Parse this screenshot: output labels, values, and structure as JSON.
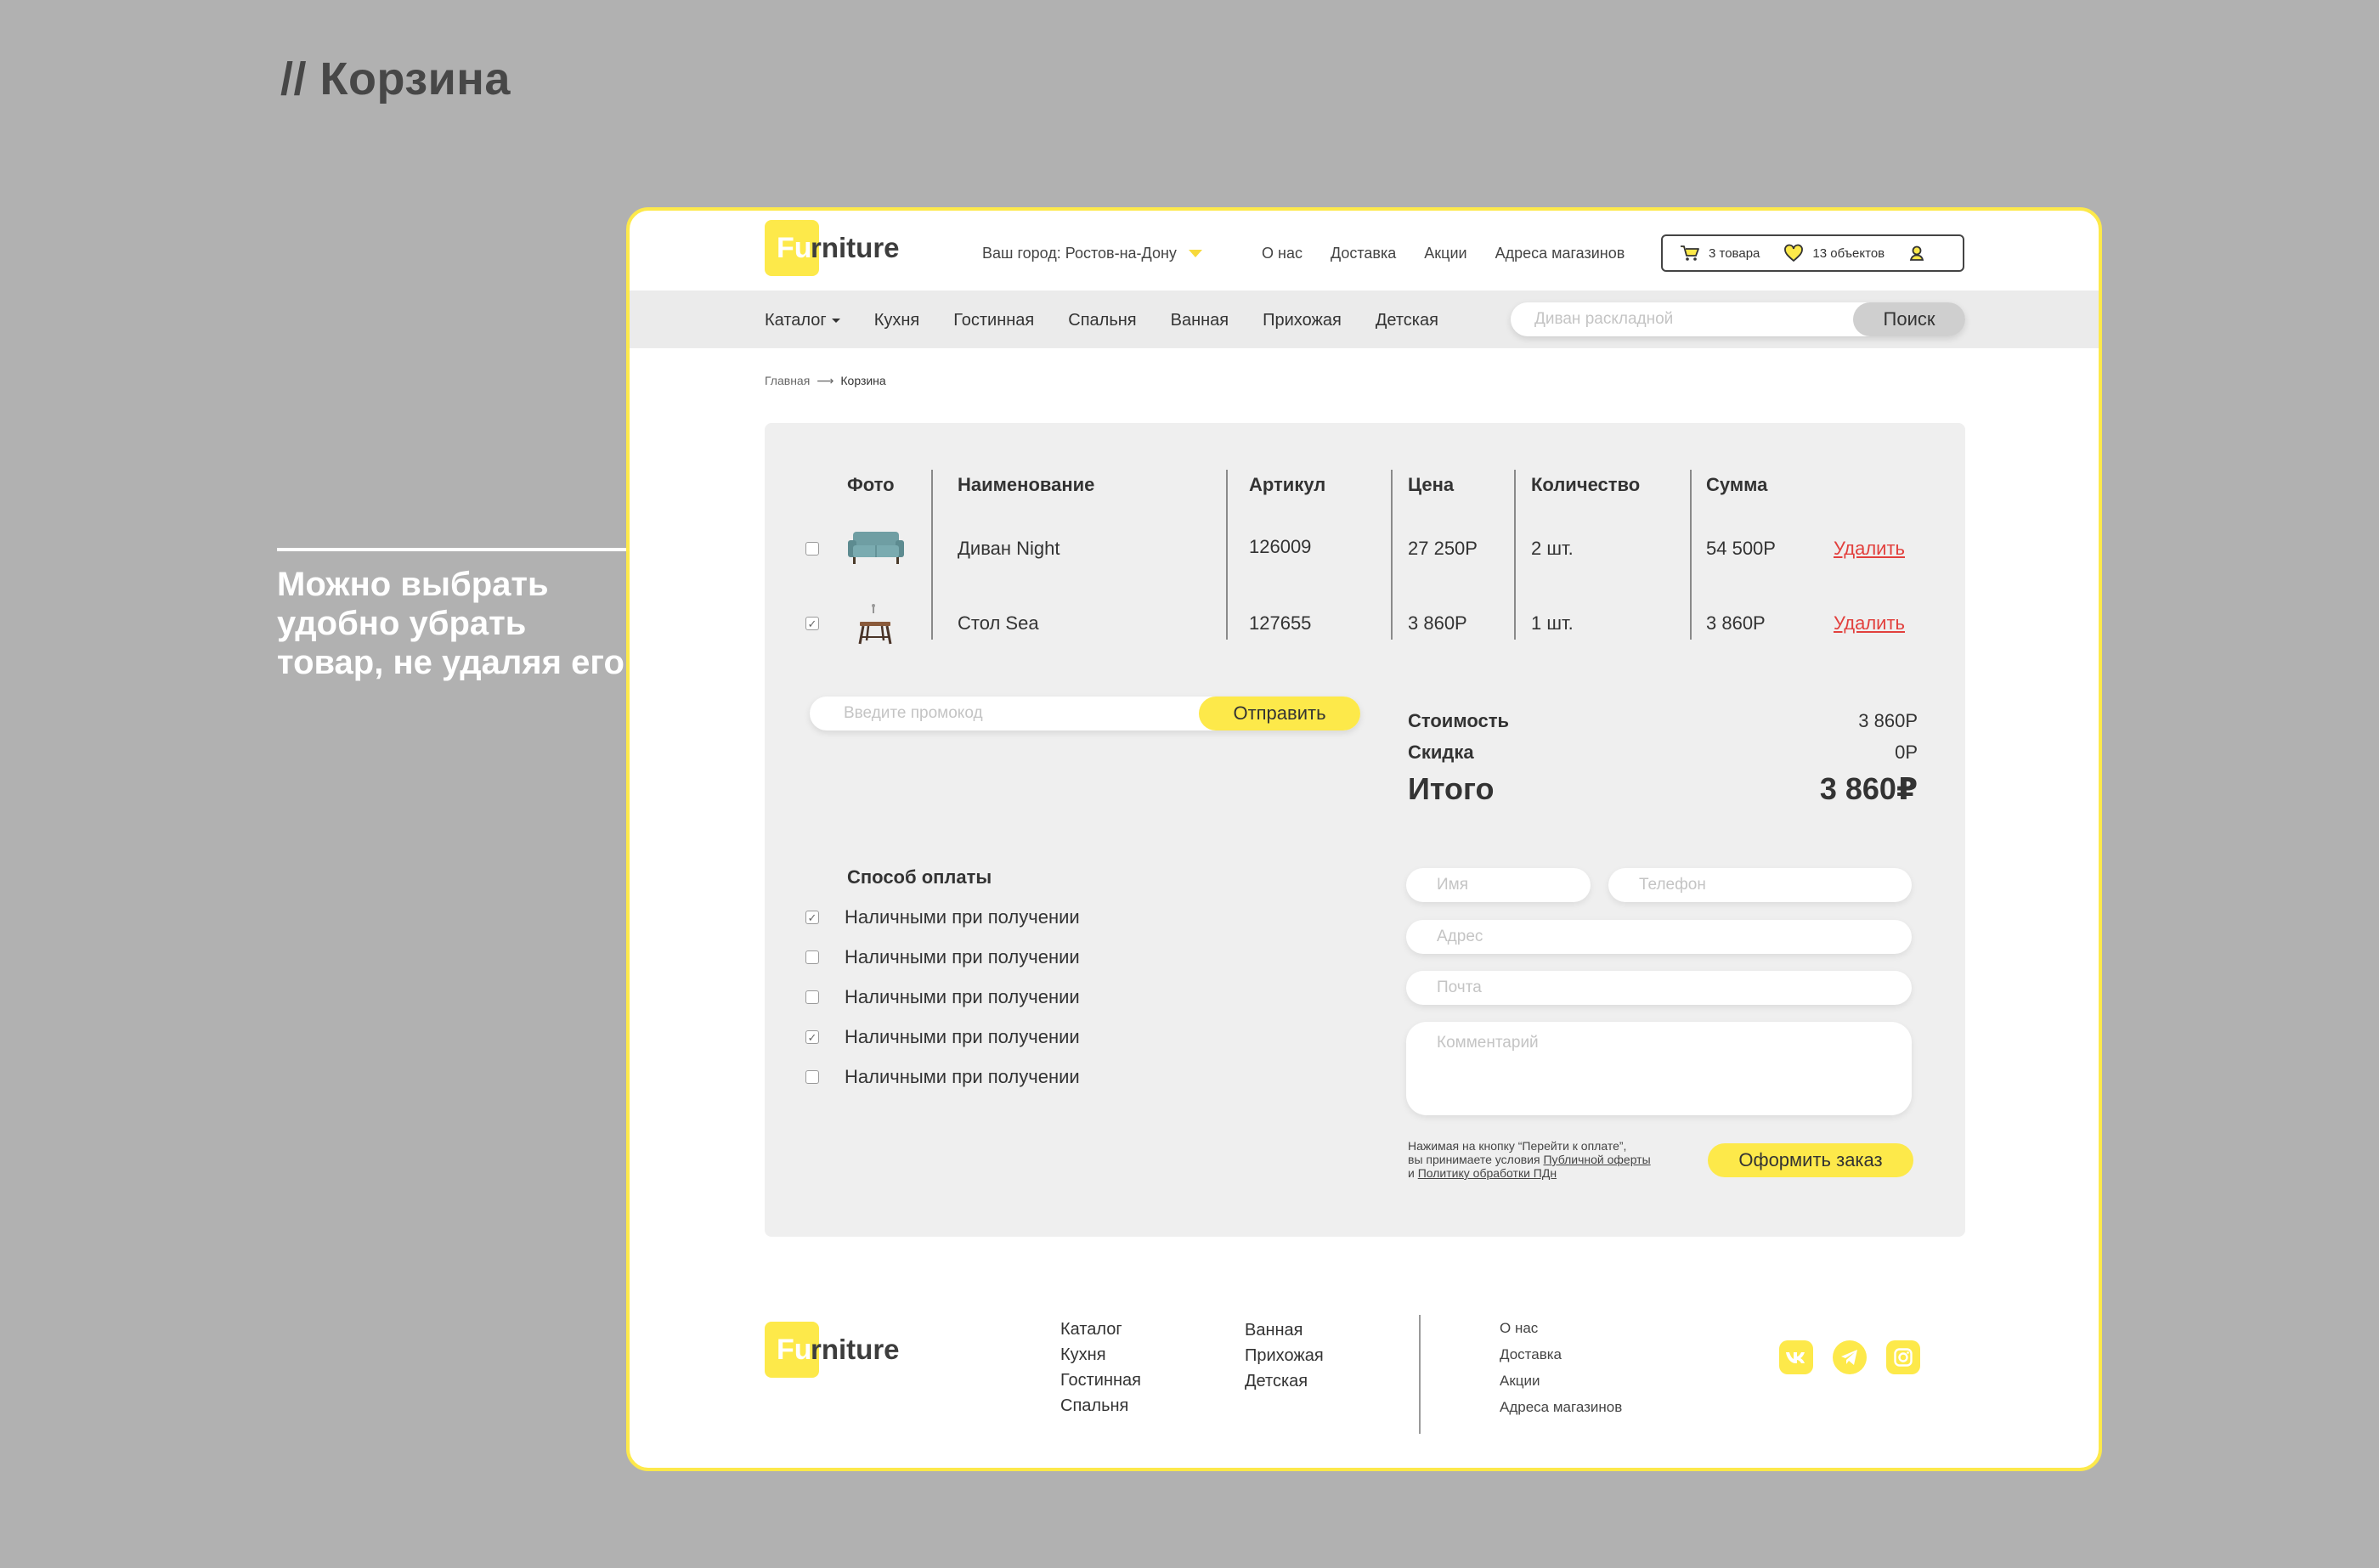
{
  "presentation": {
    "title": "// Корзина",
    "annotation": "Можно выбрать удобно убрать товар, не удаляя его"
  },
  "brand": {
    "logo_first": "Fu",
    "logo_rest": "rniture",
    "accent": "#fde94a"
  },
  "header": {
    "city_label": "Ваш город: Ростов-на-Дону",
    "nav": [
      "О нас",
      "Доставка",
      "Акции",
      "Адреса магазинов"
    ],
    "cart_count": "3 товара",
    "favorites_count": "13 объектов"
  },
  "catnav": {
    "catalog": "Каталог",
    "items": [
      "Кухня",
      "Гостинная",
      "Спальня",
      "Ванная",
      "Прихожая",
      "Детская"
    ]
  },
  "search": {
    "placeholder": "Диван раскладной",
    "button": "Поиск"
  },
  "breadcrumb": {
    "home": "Главная",
    "separator": "⟶",
    "current": "Корзина"
  },
  "cart": {
    "headers": {
      "photo": "Фото",
      "name": "Наименование",
      "sku": "Артикул",
      "price": "Цена",
      "qty": "Количество",
      "sum": "Сумма"
    },
    "rows": [
      {
        "checked": false,
        "name": "Диван Night",
        "sku": "126009",
        "price": "27 250Р",
        "qty": "2 шт.",
        "sum": "54 500Р",
        "delete": "Удалить"
      },
      {
        "checked": true,
        "name": "Стол  Sea",
        "sku": "127655",
        "price": "3 860Р",
        "qty": "1 шт.",
        "sum": "3 860Р",
        "delete": "Удалить"
      }
    ]
  },
  "promo": {
    "placeholder": "Введите промокод",
    "button": "Отправить"
  },
  "summary": {
    "cost_label": "Стоимость",
    "cost": "3 860Р",
    "discount_label": "Скидка",
    "discount": "0Р",
    "total_label": "Итого",
    "total": "3 860₽"
  },
  "payment": {
    "title": "Способ оплаты",
    "options": [
      {
        "label": "Наличными при получении",
        "checked": true
      },
      {
        "label": "Наличными при получении",
        "checked": false
      },
      {
        "label": "Наличными при получении",
        "checked": false
      },
      {
        "label": "Наличными при получении",
        "checked": true
      },
      {
        "label": "Наличными при получении",
        "checked": false
      }
    ]
  },
  "form": {
    "name_placeholder": "Имя",
    "phone_placeholder": "Телефон",
    "address_placeholder": "Адрес",
    "email_placeholder": "Почта",
    "comment_placeholder": "Комментарий",
    "legal_1": "Нажимая на кнопку “Перейти к оплате”,",
    "legal_2": "вы принимаете условия",
    "legal_link_1": "Публичной оферты",
    "legal_3": "и",
    "legal_link_2": "Политику обработки ПДн",
    "submit": "Оформить заказ"
  },
  "footer": {
    "col1": [
      "Каталог",
      "Кухня",
      "Гостинная",
      "Спальня"
    ],
    "col2": [
      "Ванная",
      "Прихожая",
      "Детская"
    ],
    "col3": [
      "О нас",
      "Доставка",
      "Акции",
      "Адреса магазинов"
    ],
    "social": [
      "vk-icon",
      "telegram-icon",
      "instagram-icon"
    ]
  }
}
